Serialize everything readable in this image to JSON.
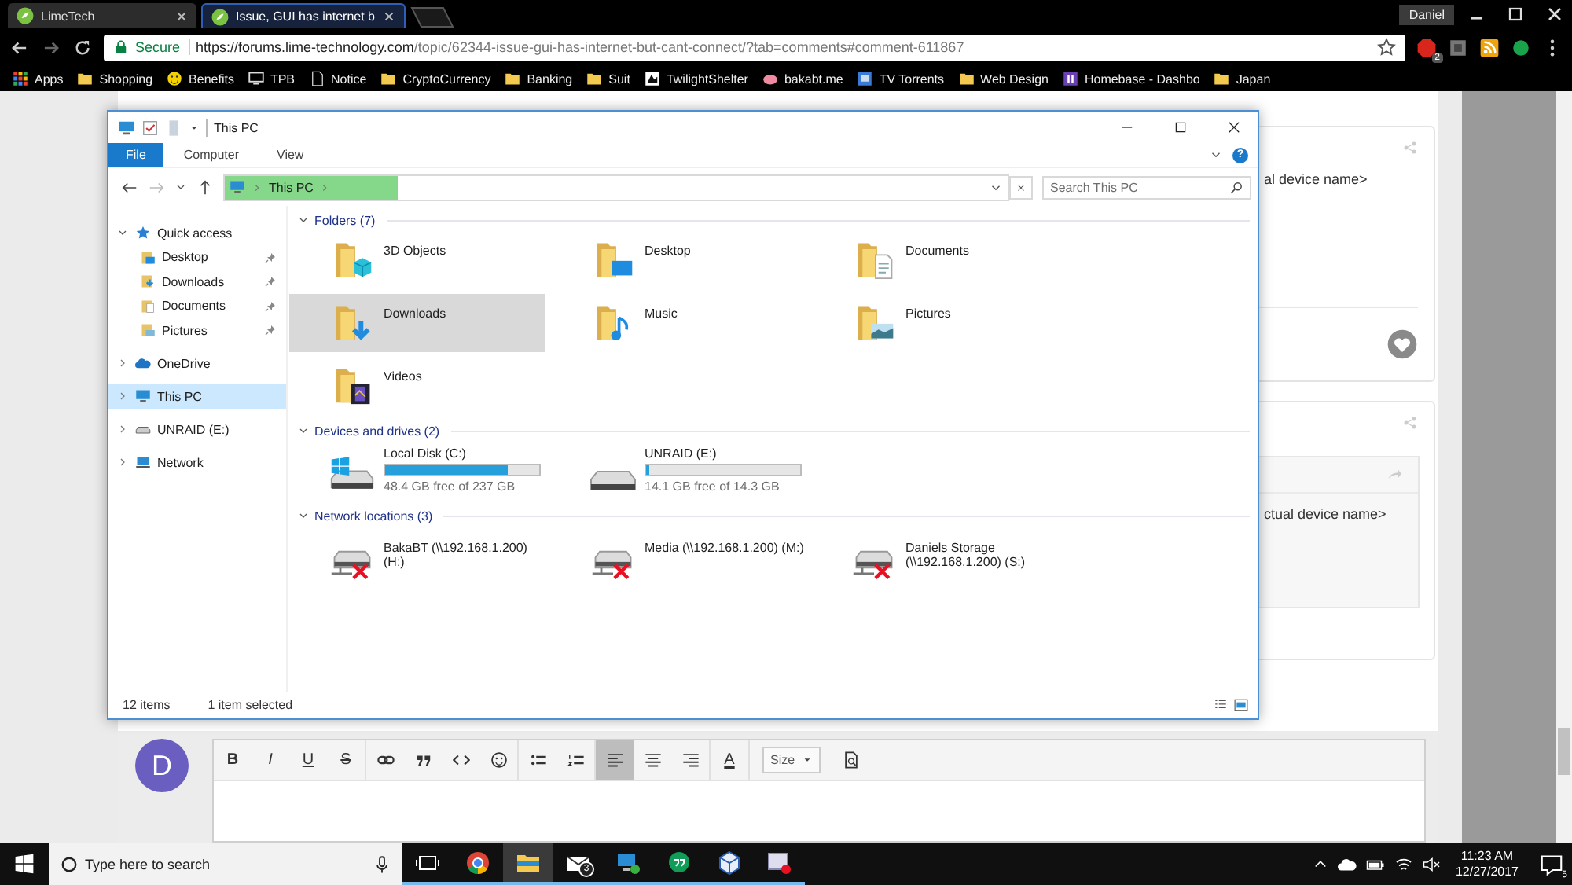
{
  "browser": {
    "tabs": [
      {
        "title": "LimeTech",
        "selected": false
      },
      {
        "title": "Issue, GUI has internet b",
        "selected": true
      }
    ],
    "profile": "Daniel",
    "secure": "Secure",
    "url_host": "https://forums.lime-technology.com",
    "url_path": "/topic/62344-issue-gui-has-internet-but-cant-connect/?tab=comments#comment-611867",
    "adblock_badge": "2",
    "bookmarks": [
      {
        "label": "Apps",
        "kind": "apps"
      },
      {
        "label": "Shopping",
        "kind": "folder"
      },
      {
        "label": "Benefits",
        "kind": "smile"
      },
      {
        "label": "TPB",
        "kind": "monitor"
      },
      {
        "label": "Notice",
        "kind": "page"
      },
      {
        "label": "CryptoCurrency",
        "kind": "folder"
      },
      {
        "label": "Banking",
        "kind": "folder"
      },
      {
        "label": "Suit",
        "kind": "folder"
      },
      {
        "label": "TwilightShelter",
        "kind": "paw"
      },
      {
        "label": "bakabt.me",
        "kind": "cloud"
      },
      {
        "label": "TV Torrents",
        "kind": "tv"
      },
      {
        "label": "Web Design",
        "kind": "folder"
      },
      {
        "label": "Homebase - Dashbo",
        "kind": "square"
      },
      {
        "label": "Japan",
        "kind": "folder"
      }
    ]
  },
  "posts": [
    {
      "kind": "reply",
      "text": "al device name>"
    },
    {
      "kind": "quote",
      "text": "ctual device name>"
    }
  ],
  "explorer": {
    "title": "This PC",
    "ribbon_tabs": [
      {
        "label": "File",
        "selected": true
      },
      {
        "label": "Computer",
        "selected": false
      },
      {
        "label": "View",
        "selected": false
      }
    ],
    "help": "?",
    "breadcrumb": "This PC",
    "address_progress": {
      "level": 0.22
    },
    "search": {
      "placeholder": "Search This PC"
    },
    "nav": [
      {
        "label": "Quick access",
        "kind": "star",
        "expanded": true,
        "selected": false,
        "children": [
          {
            "label": "Desktop",
            "kind": "desktop",
            "selected": false
          },
          {
            "label": "Downloads",
            "kind": "downloads",
            "selected": false
          },
          {
            "label": "Documents",
            "kind": "documents",
            "selected": false
          },
          {
            "label": "Pictures",
            "kind": "pictures",
            "selected": false
          }
        ]
      },
      {
        "label": "OneDrive",
        "kind": "cloud",
        "expanded": false,
        "selected": false
      },
      {
        "label": "This PC",
        "kind": "pc",
        "expanded": false,
        "selected": true
      },
      {
        "label": "UNRAID (E:)",
        "kind": "drive",
        "expanded": false,
        "selected": false
      },
      {
        "label": "Network",
        "kind": "network",
        "expanded": false,
        "selected": false
      }
    ],
    "groups": [
      {
        "title": "Folders (7)",
        "kind": "folders",
        "items": [
          {
            "name": "3D Objects",
            "kind": "objects",
            "selected": false
          },
          {
            "name": "Desktop",
            "kind": "desktop",
            "selected": false
          },
          {
            "name": "Documents",
            "kind": "documents",
            "selected": false
          },
          {
            "name": "Downloads",
            "kind": "downloads",
            "selected": true
          },
          {
            "name": "Music",
            "kind": "music",
            "selected": false
          },
          {
            "name": "Pictures",
            "kind": "pictures",
            "selected": false
          },
          {
            "name": "Videos",
            "kind": "videos",
            "selected": false
          }
        ]
      },
      {
        "title": "Devices and drives (2)",
        "kind": "drives",
        "items": [
          {
            "name": "Local Disk (C:)",
            "kind": "system",
            "level": 0.8,
            "free": "48.4 GB free of 237 GB"
          },
          {
            "name": "UNRAID (E:)",
            "kind": "removable",
            "level": 0.02,
            "free": "14.1 GB free of 14.3 GB"
          }
        ]
      },
      {
        "title": "Network locations (3)",
        "kind": "network",
        "items": [
          {
            "name": "BakaBT (\\\\192.168.1.200) (H:)"
          },
          {
            "name": "Media (\\\\192.168.1.200) (M:)"
          },
          {
            "name": "Daniels Storage\n(\\\\192.168.1.200) (S:)"
          }
        ]
      }
    ],
    "status": {
      "count": "12 items",
      "selection": "1 item selected"
    }
  },
  "editor": {
    "avatar": "D",
    "tool_groups": [
      [
        {
          "kind": "bold",
          "label": "B",
          "selected": false
        },
        {
          "kind": "italic",
          "label": "I",
          "selected": false
        },
        {
          "kind": "underline",
          "label": "U",
          "selected": false
        },
        {
          "kind": "strike",
          "label": "S",
          "selected": false
        }
      ],
      [
        {
          "kind": "link",
          "selected": false
        },
        {
          "kind": "quote",
          "selected": false
        },
        {
          "kind": "code",
          "selected": false
        },
        {
          "kind": "emoji",
          "selected": false
        }
      ],
      [
        {
          "kind": "bullets",
          "selected": false
        },
        {
          "kind": "numbers",
          "selected": false
        }
      ],
      [
        {
          "kind": "align-left",
          "selected": true
        },
        {
          "kind": "align-center",
          "selected": false
        },
        {
          "kind": "align-right",
          "selected": false
        }
      ],
      [
        {
          "kind": "color",
          "label": "A",
          "selected": false
        }
      ],
      [
        {
          "kind": "size",
          "label": "Size",
          "selected": false
        },
        {
          "kind": "preview",
          "selected": false
        }
      ]
    ]
  },
  "taskbar": {
    "search": {
      "placeholder": "Type here to search"
    },
    "apps": [
      {
        "kind": "taskview",
        "selected": false
      },
      {
        "kind": "browser",
        "selected": false
      },
      {
        "kind": "files",
        "selected": true
      },
      {
        "kind": "mail",
        "badge": "3",
        "selected": false
      },
      {
        "kind": "computer",
        "selected": false
      },
      {
        "kind": "chat",
        "selected": false
      },
      {
        "kind": "cube",
        "selected": false
      },
      {
        "kind": "screen",
        "selected": false
      }
    ],
    "time": "11:23 AM",
    "date": "12/27/2017",
    "notifications": "5"
  }
}
